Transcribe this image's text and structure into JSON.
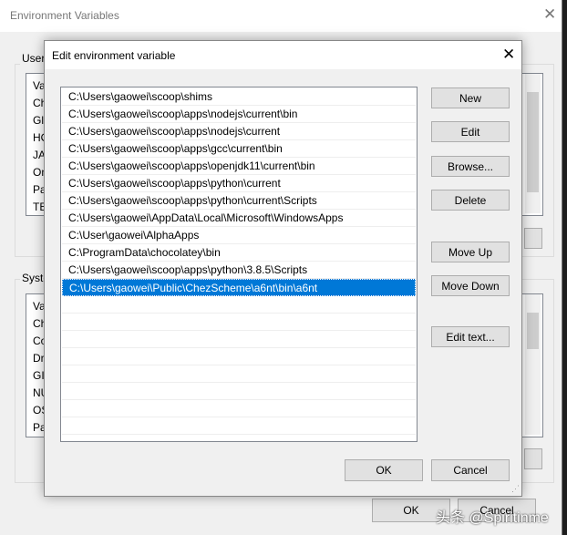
{
  "background_window": {
    "title": "Environment Variables",
    "user_group_label": "User",
    "user_list": [
      "Va",
      "Ch",
      "Gl",
      "HO",
      "JA",
      "On",
      "Pa",
      "TE"
    ],
    "system_group_label": "Syste",
    "system_list": [
      "Va",
      "Ch",
      "Co",
      "Dr",
      "GI",
      "NU",
      "OS",
      "Pa"
    ],
    "ok_label": "OK",
    "cancel_label": "Cancel"
  },
  "dialog": {
    "title": "Edit environment variable",
    "paths": [
      "C:\\Users\\gaowei\\scoop\\shims",
      "C:\\Users\\gaowei\\scoop\\apps\\nodejs\\current\\bin",
      "C:\\Users\\gaowei\\scoop\\apps\\nodejs\\current",
      "C:\\Users\\gaowei\\scoop\\apps\\gcc\\current\\bin",
      "C:\\Users\\gaowei\\scoop\\apps\\openjdk11\\current\\bin",
      "C:\\Users\\gaowei\\scoop\\apps\\python\\current",
      "C:\\Users\\gaowei\\scoop\\apps\\python\\current\\Scripts",
      "C:\\Users\\gaowei\\AppData\\Local\\Microsoft\\WindowsApps",
      "C:\\User\\gaowei\\AlphaApps",
      "C:\\ProgramData\\chocolatey\\bin",
      "C:\\Users\\gaowei\\scoop\\apps\\python\\3.8.5\\Scripts",
      "C:\\Users\\gaowei\\Public\\ChezScheme\\a6nt\\bin\\a6nt"
    ],
    "selected_index": 11,
    "buttons": {
      "new": "New",
      "edit": "Edit",
      "browse": "Browse...",
      "delete": "Delete",
      "move_up": "Move Up",
      "move_down": "Move Down",
      "edit_text": "Edit text..."
    },
    "ok_label": "OK",
    "cancel_label": "Cancel"
  },
  "watermark": "头条 @Spiritinme",
  "colors": {
    "selection": "#0078d7"
  }
}
